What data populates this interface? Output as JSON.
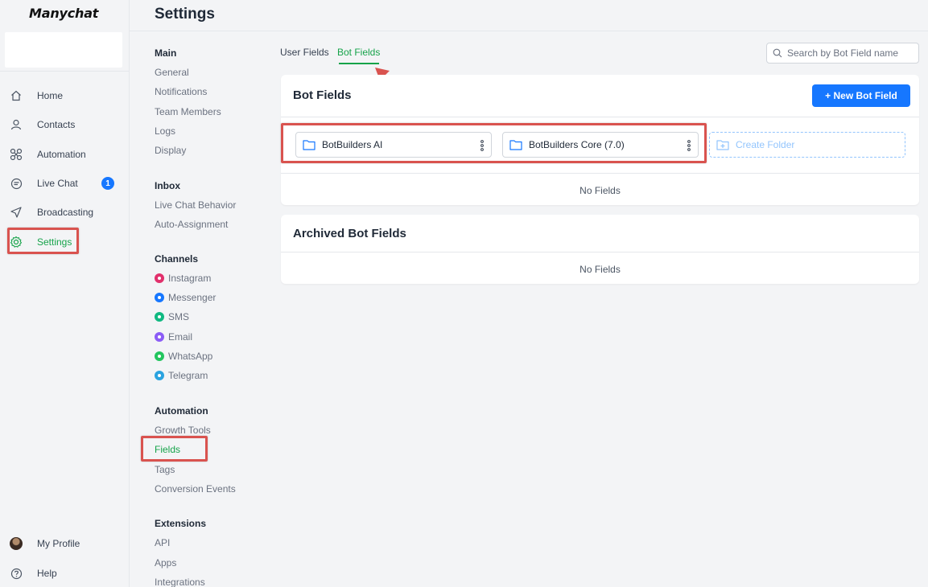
{
  "brand": {
    "logo_text": "Manychat"
  },
  "header": {
    "title": "Settings"
  },
  "app_nav": {
    "items": [
      {
        "label": "Home",
        "icon": "home-icon"
      },
      {
        "label": "Contacts",
        "icon": "user-icon"
      },
      {
        "label": "Automation",
        "icon": "automation-icon"
      },
      {
        "label": "Live Chat",
        "icon": "chat-icon",
        "badge": "1"
      },
      {
        "label": "Broadcasting",
        "icon": "send-icon"
      },
      {
        "label": "Settings",
        "icon": "gear-icon",
        "active": true
      }
    ],
    "bottom": [
      {
        "label": "My Profile",
        "icon": "avatar"
      },
      {
        "label": "Help",
        "icon": "help-icon"
      }
    ]
  },
  "settings_nav": {
    "groups": [
      {
        "title": "Main",
        "items": [
          "General",
          "Notifications",
          "Team Members",
          "Logs",
          "Display"
        ]
      },
      {
        "title": "Inbox",
        "items": [
          "Live Chat Behavior",
          "Auto-Assignment"
        ]
      },
      {
        "title": "Channels",
        "items": [
          "Instagram",
          "Messenger",
          "SMS",
          "Email",
          "WhatsApp",
          "Telegram"
        ]
      },
      {
        "title": "Automation",
        "items": [
          "Growth Tools",
          "Fields",
          "Tags",
          "Conversion Events"
        ]
      },
      {
        "title": "Extensions",
        "items": [
          "API",
          "Apps",
          "Integrations"
        ]
      }
    ],
    "active_item": "Fields",
    "channel_colors": {
      "Instagram": "#e1306c",
      "Messenger": "#1677ff",
      "SMS": "#10b981",
      "Email": "#8b5cf6",
      "WhatsApp": "#22c55e",
      "Telegram": "#2aa3e0"
    }
  },
  "tabs": {
    "user_fields": "User Fields",
    "bot_fields": "Bot Fields",
    "active": "Bot Fields"
  },
  "search": {
    "placeholder": "Search by Bot Field name",
    "value": ""
  },
  "bot_fields_card": {
    "title": "Bot Fields",
    "new_button": "+ New Bot Field",
    "folders": [
      "BotBuilders AI",
      "BotBuilders Core (7.0)"
    ],
    "create_folder": "Create Folder",
    "empty_text": "No Fields"
  },
  "archived_card": {
    "title": "Archived Bot Fields",
    "empty_text": "No Fields"
  },
  "colors": {
    "accent_green": "#16a34a",
    "primary_blue": "#1677ff",
    "highlight_red": "#d9534f"
  }
}
